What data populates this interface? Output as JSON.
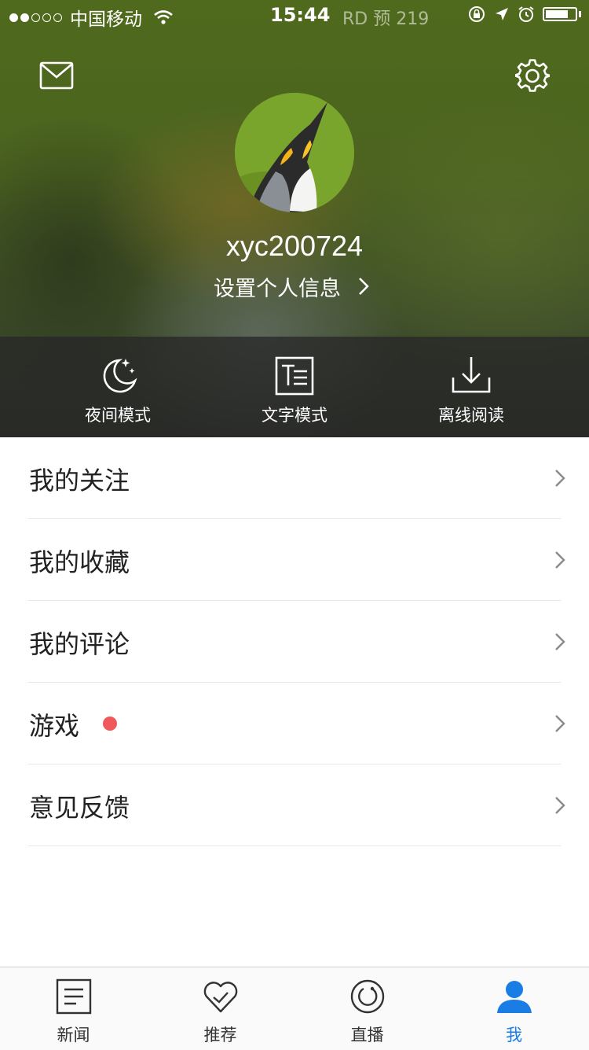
{
  "status_bar": {
    "carrier": "中国移动",
    "time": "15:44",
    "extra": "RD 预 219"
  },
  "header": {
    "username": "xyc200724",
    "profile_link": "设置个人信息"
  },
  "modes": [
    {
      "label": "夜间模式",
      "icon": "moon-icon"
    },
    {
      "label": "文字模式",
      "icon": "text-mode-icon"
    },
    {
      "label": "离线阅读",
      "icon": "download-icon"
    }
  ],
  "menu": [
    {
      "label": "我的关注"
    },
    {
      "label": "我的收藏"
    },
    {
      "label": "我的评论"
    },
    {
      "label": "游戏",
      "badge": true
    },
    {
      "label": "意见反馈"
    }
  ],
  "tabs": [
    {
      "label": "新闻",
      "icon": "news-icon"
    },
    {
      "label": "推荐",
      "icon": "heart-check-icon"
    },
    {
      "label": "直播",
      "icon": "live-icon"
    },
    {
      "label": "我",
      "icon": "user-icon",
      "active": true
    }
  ],
  "colors": {
    "accent": "#1a7de6",
    "badge": "#f0585c"
  }
}
